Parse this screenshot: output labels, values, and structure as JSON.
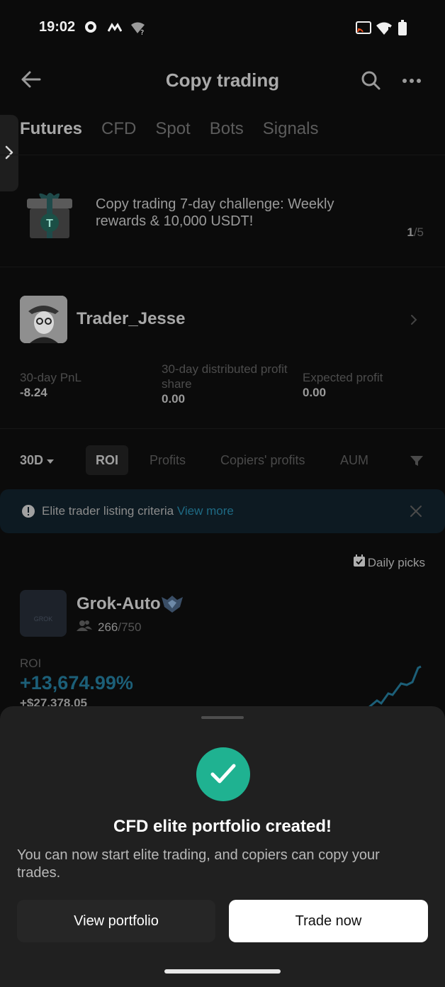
{
  "status_bar": {
    "time": "19:02",
    "icons": [
      "gear-icon",
      "app-icon",
      "wifi-question-icon",
      "cast-icon",
      "wifi-icon",
      "battery-icon"
    ]
  },
  "header": {
    "title": "Copy trading",
    "icons": [
      "back-arrow-icon",
      "search-icon",
      "more-icon"
    ]
  },
  "tabs": [
    {
      "label": "Futures",
      "active": true
    },
    {
      "label": "CFD",
      "active": false
    },
    {
      "label": "Spot",
      "active": false
    },
    {
      "label": "Bots",
      "active": false
    },
    {
      "label": "Signals",
      "active": false
    }
  ],
  "banner": {
    "text": "Copy trading 7-day challenge: Weekly rewards & 10,000 USDT!",
    "page_current": "1",
    "page_total": "/5"
  },
  "trader": {
    "name": "Trader_Jesse",
    "stats": [
      {
        "label": "30-day PnL",
        "value": "-8.24"
      },
      {
        "label": "30-day distributed profit share",
        "value": "0.00"
      },
      {
        "label": "Expected profit",
        "value": "0.00"
      }
    ]
  },
  "filters": {
    "period": "30D",
    "items": [
      "ROI",
      "Profits",
      "Copiers' profits",
      "AUM"
    ]
  },
  "notice": {
    "text": "Elite trader listing criteria",
    "link": "View more"
  },
  "daily_picks": "Daily picks",
  "listing": {
    "name": "Grok-Auto",
    "logo_text": "GROK",
    "copiers": "266",
    "capacity": "/750",
    "roi_label": "ROI",
    "roi": "+13,674.99%",
    "pnl": "+$27,378.05"
  },
  "sheet": {
    "title": "CFD elite portfolio created!",
    "description": "You can now start elite trading, and copiers can copy your trades.",
    "view_label": "View portfolio",
    "trade_label": "Trade now"
  },
  "colors": {
    "accent_green": "#1fb291",
    "roi_blue": "#1c5f78"
  }
}
